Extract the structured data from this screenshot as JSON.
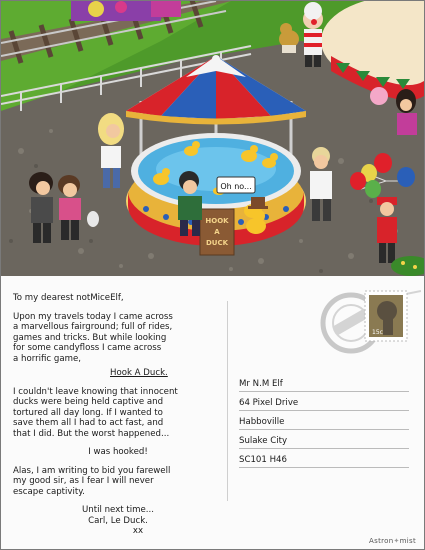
{
  "scene": {
    "speech_bubble": "Oh no...",
    "sign_text": [
      "HOOK",
      "A",
      "DUCK"
    ]
  },
  "letter": {
    "greeting": "To my dearest notMiceElf,",
    "para1_lines": [
      "Upon my travels today I came across",
      "a marvellous fairground; full of rides,",
      "games and tricks. But while looking",
      "for some candyfloss I came across",
      "a horrific game,"
    ],
    "game_name": "Hook A Duck.",
    "para2_lines": [
      "I couldn't leave knowing that innocent",
      "ducks were being held captive and",
      "tortured all day long. If I wanted to",
      "save them all I had to act fast, and",
      "that I did. But the worst happened..."
    ],
    "hooked": "I was hooked!",
    "para3_lines": [
      "Alas, I am writing to bid you farewell",
      "my good sir, as I fear I will never",
      "escape captivity."
    ],
    "signoff": "Until next time...",
    "signature": "Carl, Le Duck.",
    "kisses": "xx"
  },
  "address": {
    "name": "Mr N.M Elf",
    "street": "64 Pixel Drive",
    "town": "Habboville",
    "city": "Sulake City",
    "postcode": "SC101 H46"
  },
  "stamp": {
    "value": "15c"
  },
  "credit": {
    "prefix": "Astron",
    "suffix": "mist"
  },
  "colors": {
    "canopy_red": "#d8232a",
    "canopy_blue": "#2a5fb8",
    "canopy_white": "#f4f4f4",
    "water": "#4fb0e0",
    "duck": "#f7c52a",
    "ground": "#6f6a62",
    "grass": "#4e9a2a"
  }
}
